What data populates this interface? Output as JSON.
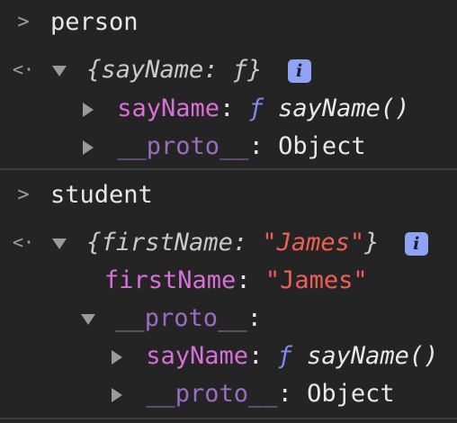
{
  "console": {
    "entry1": {
      "input": "person",
      "result_preview": "{sayName: ƒ}",
      "info_badge": "i",
      "props": [
        {
          "key": "sayName",
          "colon": ":",
          "f": "ƒ",
          "sig": "sayName()"
        },
        {
          "key": "__proto__",
          "colon": ":",
          "value": "Object"
        }
      ]
    },
    "entry2": {
      "input": "student",
      "result_preview_open": "{firstName: ",
      "result_preview_value": "\"James\"",
      "result_preview_close": "}",
      "info_badge": "i",
      "firstName": {
        "key": "firstName",
        "colon": ":",
        "value": "\"James\""
      },
      "proto": {
        "key": "__proto__",
        "colon": ":"
      },
      "proto_props": [
        {
          "key": "sayName",
          "colon": ":",
          "f": "ƒ",
          "sig": "sayName()"
        },
        {
          "key": "__proto__",
          "colon": ":",
          "value": "Object"
        }
      ]
    }
  },
  "icons": {
    "input_prompt": ">",
    "result_prompt": "<·"
  }
}
